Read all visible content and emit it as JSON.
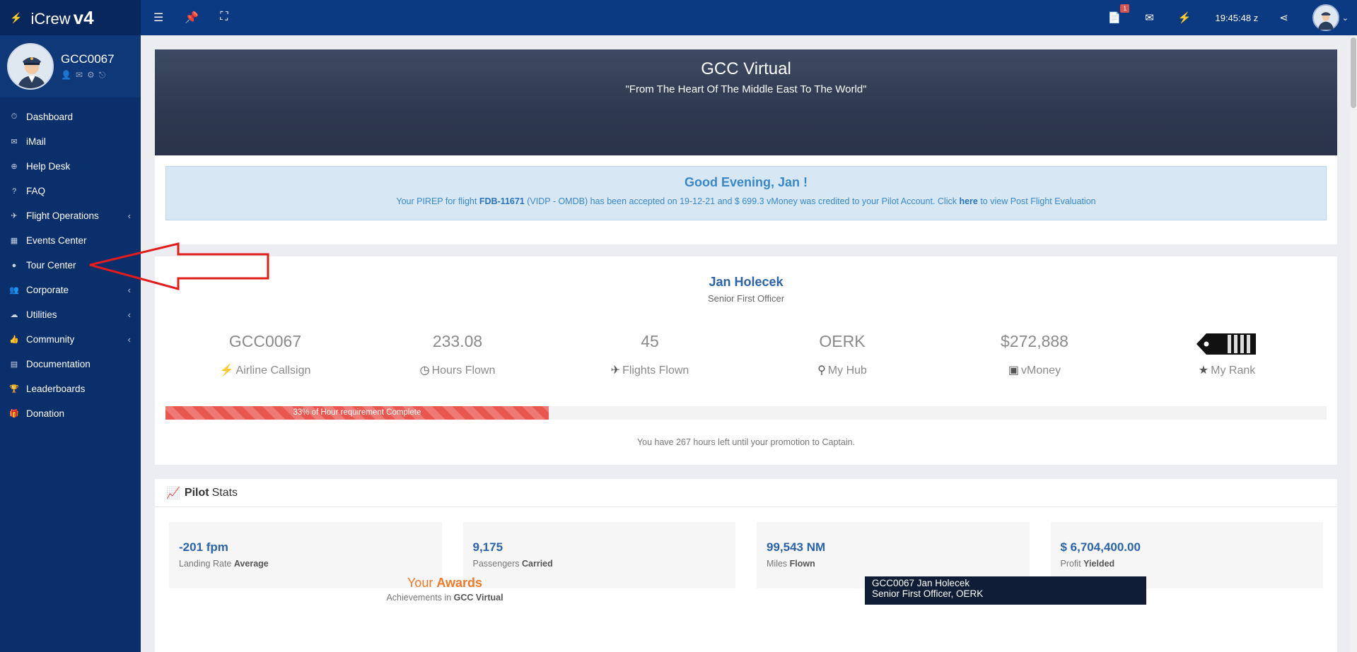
{
  "brand": {
    "name": "iCrew",
    "version": "v4"
  },
  "profile": {
    "callsign": "GCC0067"
  },
  "nav": [
    {
      "label": "Dashboard",
      "icon": "⏱",
      "has_children": false
    },
    {
      "label": "iMail",
      "icon": "✉",
      "has_children": false
    },
    {
      "label": "Help Desk",
      "icon": "⊕",
      "has_children": false
    },
    {
      "label": "FAQ",
      "icon": "?",
      "has_children": false
    },
    {
      "label": "Flight Operations",
      "icon": "✈",
      "has_children": true
    },
    {
      "label": "Events Center",
      "icon": "▦",
      "has_children": false
    },
    {
      "label": "Tour Center",
      "icon": "●",
      "has_children": false
    },
    {
      "label": "Corporate",
      "icon": "👥",
      "has_children": true
    },
    {
      "label": "Utilities",
      "icon": "☁",
      "has_children": true
    },
    {
      "label": "Community",
      "icon": "👍",
      "has_children": true
    },
    {
      "label": "Documentation",
      "icon": "▤",
      "has_children": false
    },
    {
      "label": "Leaderboards",
      "icon": "🏆",
      "has_children": false
    },
    {
      "label": "Donation",
      "icon": "🎁",
      "has_children": false
    }
  ],
  "topbar": {
    "time": "19:45:48 z",
    "notification_count": "1"
  },
  "hero": {
    "title": "GCC Virtual",
    "subtitle": "\"From The Heart Of The Middle East To The World\""
  },
  "welcome": {
    "greeting": "Good Evening, Jan !",
    "msg_prefix": "Your PIREP for flight ",
    "flight": "FDB-11671",
    "msg_middle": " (VIDP - OMDB) has been accepted on 19-12-21 and $ 699.3 vMoney was credited to your Pilot Account. Click ",
    "link": "here",
    "msg_suffix": " to view Post Flight Evaluation"
  },
  "pilot": {
    "name": "Jan Holecek",
    "rank": "Senior First Officer",
    "stats": [
      {
        "value": "GCC0067",
        "label": "Airline Callsign",
        "icon": "⚡"
      },
      {
        "value": "233.08",
        "label": "Hours Flown",
        "icon": "◷"
      },
      {
        "value": "45",
        "label": "Flights Flown",
        "icon": "✈"
      },
      {
        "value": "OERK",
        "label": "My Hub",
        "icon": "⚲"
      },
      {
        "value": "$272,888",
        "label": "vMoney",
        "icon": "▣"
      },
      {
        "value": "",
        "label": "My Rank",
        "icon": "★"
      }
    ],
    "progress_percent": 33,
    "progress_label": "33% of Hour requirement Complete",
    "promotion_text": "You have 267 hours left until your promotion to Captain."
  },
  "pilot_stats": {
    "heading_bold": "Pilot",
    "heading_rest": "Stats",
    "boxes": [
      {
        "value": "-201 fpm",
        "caption": "Landing Rate",
        "caption_bold": "Average"
      },
      {
        "value": "9,175",
        "caption": "Passengers",
        "caption_bold": "Carried"
      },
      {
        "value": "99,543 NM",
        "caption": "Miles",
        "caption_bold": "Flown"
      },
      {
        "value": "$ 6,704,400.00",
        "caption": "Profit",
        "caption_bold": "Yielded"
      }
    ]
  },
  "awards": {
    "heading_light": "Your",
    "heading_bold": "Awards",
    "sub_prefix": "Achievements in",
    "sub_bold": "GCC Virtual"
  },
  "signature": {
    "line1": "GCC0067 Jan  Holecek",
    "line2": "Senior First Officer, OERK"
  },
  "colors": {
    "sidebar": "#0b2f6b",
    "topbar": "#0b3a83",
    "accent": "#2a63a8",
    "progress": "#e8574f",
    "arrow": "#e21b1b"
  }
}
